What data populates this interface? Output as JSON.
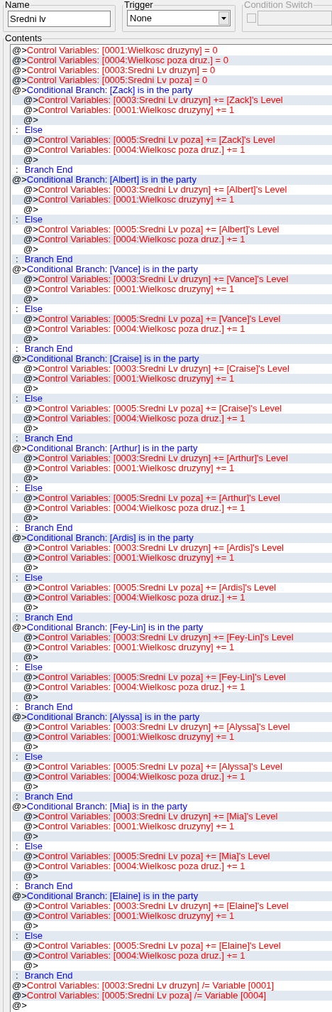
{
  "name_group": {
    "label": "Name",
    "value": "Sredni lv"
  },
  "trigger_group": {
    "label": "Trigger",
    "value": "None"
  },
  "condition_switch_group": {
    "label": "Condition Switch",
    "disabled": true,
    "checked": false
  },
  "contents": {
    "label": "Contents",
    "commands": [
      {
        "kind": "command",
        "prefix": "@>",
        "text": "Control Variables: [0001:Wielkosc druzyny] = 0"
      },
      {
        "kind": "command",
        "prefix": "@>",
        "text": "Control Variables: [0004:Wielkosc poza druz.] = 0"
      },
      {
        "kind": "command",
        "prefix": "@>",
        "text": "Control Variables: [0003:Sredni Lv druzyn] = 0"
      },
      {
        "kind": "command",
        "prefix": "@>",
        "text": "Control Variables: [0005:Sredni Lv poza] = 0"
      },
      {
        "kind": "branch",
        "prefix": "@>",
        "text": "Conditional Branch: [Zack] is in the party",
        "children": [
          {
            "kind": "command",
            "prefix": "@>",
            "text": "Control Variables: [0003:Sredni Lv druzyn] += [Zack]'s Level"
          },
          {
            "kind": "command",
            "prefix": "@>",
            "text": "Control Variables: [0001:Wielkosc druzyny] += 1"
          },
          {
            "kind": "empty",
            "prefix": "@>"
          }
        ]
      },
      {
        "kind": "else",
        "prefix": ":",
        "text": "Else",
        "children": [
          {
            "kind": "command",
            "prefix": "@>",
            "text": "Control Variables: [0005:Sredni Lv poza] += [Zack]'s Level"
          },
          {
            "kind": "command",
            "prefix": "@>",
            "text": "Control Variables: [0004:Wielkosc poza druz.] += 1"
          },
          {
            "kind": "empty",
            "prefix": "@>"
          }
        ]
      },
      {
        "kind": "end",
        "prefix": ":",
        "text": "Branch End"
      },
      {
        "kind": "branch",
        "prefix": "@>",
        "text": "Conditional Branch: [Albert] is in the party",
        "children": [
          {
            "kind": "command",
            "prefix": "@>",
            "text": "Control Variables: [0003:Sredni Lv druzyn] += [Albert]'s Level"
          },
          {
            "kind": "command",
            "prefix": "@>",
            "text": "Control Variables: [0001:Wielkosc druzyny] += 1"
          },
          {
            "kind": "empty",
            "prefix": "@>"
          }
        ]
      },
      {
        "kind": "else",
        "prefix": ":",
        "text": "Else",
        "children": [
          {
            "kind": "command",
            "prefix": "@>",
            "text": "Control Variables: [0005:Sredni Lv poza] += [Albert]'s Level"
          },
          {
            "kind": "command",
            "prefix": "@>",
            "text": "Control Variables: [0004:Wielkosc poza druz.] += 1"
          },
          {
            "kind": "empty",
            "prefix": "@>"
          }
        ]
      },
      {
        "kind": "end",
        "prefix": ":",
        "text": "Branch End"
      },
      {
        "kind": "branch",
        "prefix": "@>",
        "text": "Conditional Branch: [Vance] is in the party",
        "children": [
          {
            "kind": "command",
            "prefix": "@>",
            "text": "Control Variables: [0003:Sredni Lv druzyn] += [Vance]'s Level"
          },
          {
            "kind": "command",
            "prefix": "@>",
            "text": "Control Variables: [0001:Wielkosc druzyny] += 1"
          },
          {
            "kind": "empty",
            "prefix": "@>"
          }
        ]
      },
      {
        "kind": "else",
        "prefix": ":",
        "text": "Else",
        "children": [
          {
            "kind": "command",
            "prefix": "@>",
            "text": "Control Variables: [0005:Sredni Lv poza] += [Vance]'s Level"
          },
          {
            "kind": "command",
            "prefix": "@>",
            "text": "Control Variables: [0004:Wielkosc poza druz.] += 1"
          },
          {
            "kind": "empty",
            "prefix": "@>"
          }
        ]
      },
      {
        "kind": "end",
        "prefix": ":",
        "text": "Branch End"
      },
      {
        "kind": "branch",
        "prefix": "@>",
        "text": "Conditional Branch: [Craise] is in the party",
        "children": [
          {
            "kind": "command",
            "prefix": "@>",
            "text": "Control Variables: [0003:Sredni Lv druzyn] += [Craise]'s Level"
          },
          {
            "kind": "command",
            "prefix": "@>",
            "text": "Control Variables: [0001:Wielkosc druzyny] += 1"
          },
          {
            "kind": "empty",
            "prefix": "@>"
          }
        ]
      },
      {
        "kind": "else",
        "prefix": ":",
        "text": "Else",
        "children": [
          {
            "kind": "command",
            "prefix": "@>",
            "text": "Control Variables: [0005:Sredni Lv poza] += [Craise]'s Level"
          },
          {
            "kind": "command",
            "prefix": "@>",
            "text": "Control Variables: [0004:Wielkosc poza druz.] += 1"
          },
          {
            "kind": "empty",
            "prefix": "@>"
          }
        ]
      },
      {
        "kind": "end",
        "prefix": ":",
        "text": "Branch End"
      },
      {
        "kind": "branch",
        "prefix": "@>",
        "text": "Conditional Branch: [Arthur] is in the party",
        "children": [
          {
            "kind": "command",
            "prefix": "@>",
            "text": "Control Variables: [0003:Sredni Lv druzyn] += [Arthur]'s Level"
          },
          {
            "kind": "command",
            "prefix": "@>",
            "text": "Control Variables: [0001:Wielkosc druzyny] += 1"
          },
          {
            "kind": "empty",
            "prefix": "@>"
          }
        ]
      },
      {
        "kind": "else",
        "prefix": ":",
        "text": "Else",
        "children": [
          {
            "kind": "command",
            "prefix": "@>",
            "text": "Control Variables: [0005:Sredni Lv poza] += [Arthur]'s Level"
          },
          {
            "kind": "command",
            "prefix": "@>",
            "text": "Control Variables: [0004:Wielkosc poza druz.] += 1"
          },
          {
            "kind": "empty",
            "prefix": "@>"
          }
        ]
      },
      {
        "kind": "end",
        "prefix": ":",
        "text": "Branch End"
      },
      {
        "kind": "branch",
        "prefix": "@>",
        "text": "Conditional Branch: [Ardis] is in the party",
        "children": [
          {
            "kind": "command",
            "prefix": "@>",
            "text": "Control Variables: [0003:Sredni Lv druzyn] += [Ardis]'s Level"
          },
          {
            "kind": "command",
            "prefix": "@>",
            "text": "Control Variables: [0001:Wielkosc druzyny] += 1"
          },
          {
            "kind": "empty",
            "prefix": "@>"
          }
        ]
      },
      {
        "kind": "else",
        "prefix": ":",
        "text": "Else",
        "children": [
          {
            "kind": "command",
            "prefix": "@>",
            "text": "Control Variables: [0005:Sredni Lv poza] += [Ardis]'s Level"
          },
          {
            "kind": "command",
            "prefix": "@>",
            "text": "Control Variables: [0004:Wielkosc poza druz.] += 1"
          },
          {
            "kind": "empty",
            "prefix": "@>"
          }
        ]
      },
      {
        "kind": "end",
        "prefix": ":",
        "text": "Branch End"
      },
      {
        "kind": "branch",
        "prefix": "@>",
        "text": "Conditional Branch: [Fey-Lin] is in the party",
        "children": [
          {
            "kind": "command",
            "prefix": "@>",
            "text": "Control Variables: [0003:Sredni Lv druzyn] += [Fey-Lin]'s Level"
          },
          {
            "kind": "command",
            "prefix": "@>",
            "text": "Control Variables: [0001:Wielkosc druzyny] += 1"
          },
          {
            "kind": "empty",
            "prefix": "@>"
          }
        ]
      },
      {
        "kind": "else",
        "prefix": ":",
        "text": "Else",
        "children": [
          {
            "kind": "command",
            "prefix": "@>",
            "text": "Control Variables: [0005:Sredni Lv poza] += [Fey-Lin]'s Level"
          },
          {
            "kind": "command",
            "prefix": "@>",
            "text": "Control Variables: [0004:Wielkosc poza druz.] += 1"
          },
          {
            "kind": "empty",
            "prefix": "@>"
          }
        ]
      },
      {
        "kind": "end",
        "prefix": ":",
        "text": "Branch End"
      },
      {
        "kind": "branch",
        "prefix": "@>",
        "text": "Conditional Branch: [Alyssa] is in the party",
        "children": [
          {
            "kind": "command",
            "prefix": "@>",
            "text": "Control Variables: [0003:Sredni Lv druzyn] += [Alyssa]'s Level"
          },
          {
            "kind": "command",
            "prefix": "@>",
            "text": "Control Variables: [0001:Wielkosc druzyny] += 1"
          },
          {
            "kind": "empty",
            "prefix": "@>"
          }
        ]
      },
      {
        "kind": "else",
        "prefix": ":",
        "text": "Else",
        "children": [
          {
            "kind": "command",
            "prefix": "@>",
            "text": "Control Variables: [0005:Sredni Lv poza] += [Alyssa]'s Level"
          },
          {
            "kind": "command",
            "prefix": "@>",
            "text": "Control Variables: [0004:Wielkosc poza druz.] += 1"
          },
          {
            "kind": "empty",
            "prefix": "@>"
          }
        ]
      },
      {
        "kind": "end",
        "prefix": ":",
        "text": "Branch End"
      },
      {
        "kind": "branch",
        "prefix": "@>",
        "text": "Conditional Branch: [Mia] is in the party",
        "children": [
          {
            "kind": "command",
            "prefix": "@>",
            "text": "Control Variables: [0003:Sredni Lv druzyn] += [Mia]'s Level"
          },
          {
            "kind": "command",
            "prefix": "@>",
            "text": "Control Variables: [0001:Wielkosc druzyny] += 1"
          },
          {
            "kind": "empty",
            "prefix": "@>"
          }
        ]
      },
      {
        "kind": "else",
        "prefix": ":",
        "text": "Else",
        "children": [
          {
            "kind": "command",
            "prefix": "@>",
            "text": "Control Variables: [0005:Sredni Lv poza] += [Mia]'s Level"
          },
          {
            "kind": "command",
            "prefix": "@>",
            "text": "Control Variables: [0004:Wielkosc poza druz.] += 1"
          },
          {
            "kind": "empty",
            "prefix": "@>"
          }
        ]
      },
      {
        "kind": "end",
        "prefix": ":",
        "text": "Branch End"
      },
      {
        "kind": "branch",
        "prefix": "@>",
        "text": "Conditional Branch: [Elaine] is in the party",
        "children": [
          {
            "kind": "command",
            "prefix": "@>",
            "text": "Control Variables: [0003:Sredni Lv druzyn] += [Elaine]'s Level"
          },
          {
            "kind": "command",
            "prefix": "@>",
            "text": "Control Variables: [0001:Wielkosc druzyny] += 1"
          },
          {
            "kind": "empty",
            "prefix": "@>"
          }
        ]
      },
      {
        "kind": "else",
        "prefix": ":",
        "text": "Else",
        "children": [
          {
            "kind": "command",
            "prefix": "@>",
            "text": "Control Variables: [0005:Sredni Lv poza] += [Elaine]'s Level"
          },
          {
            "kind": "command",
            "prefix": "@>",
            "text": "Control Variables: [0004:Wielkosc poza druz.] += 1"
          },
          {
            "kind": "empty",
            "prefix": "@>"
          }
        ]
      },
      {
        "kind": "end",
        "prefix": ":",
        "text": "Branch End"
      },
      {
        "kind": "command",
        "prefix": "@>",
        "text": "Control Variables: [0003:Sredni Lv druzyn] /= Variable [0001]"
      },
      {
        "kind": "command",
        "prefix": "@>",
        "text": "Control Variables: [0005:Sredni Lv poza] /= Variable [0004]"
      },
      {
        "kind": "empty",
        "prefix": "@>"
      }
    ]
  }
}
